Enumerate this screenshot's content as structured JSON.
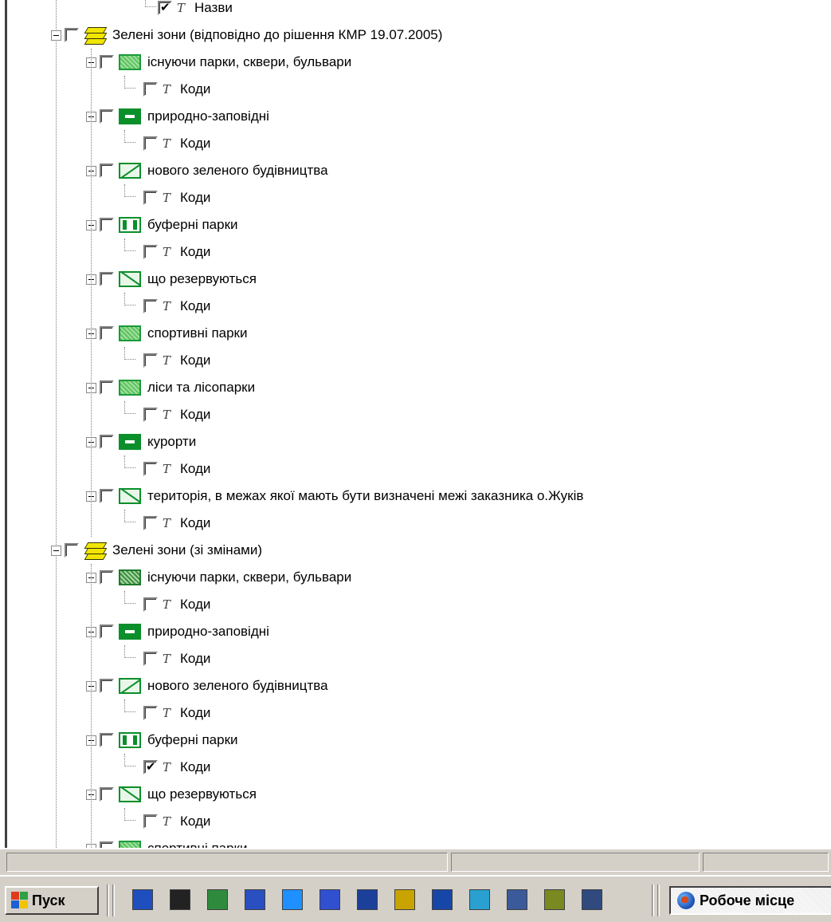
{
  "tree": {
    "top_partial": {
      "label": "Назви",
      "checked": true
    },
    "groups": [
      {
        "label": "Зелені зони (відповідно до рішення КМР 19.07.2005)",
        "checked": false,
        "layers": [
          {
            "label": "існуючи парки, сквери, бульвари",
            "symbol": "hatch",
            "checked": false,
            "child": {
              "label": "Коди",
              "checked": false
            }
          },
          {
            "label": "природно-заповідні",
            "symbol": "solid",
            "checked": false,
            "child": {
              "label": "Коди",
              "checked": false
            }
          },
          {
            "label": "нового зеленого будівництва",
            "symbol": "diag",
            "checked": false,
            "child": {
              "label": "Коди",
              "checked": false
            }
          },
          {
            "label": "буферні парки",
            "symbol": "buf",
            "checked": false,
            "child": {
              "label": "Коди",
              "checked": false
            }
          },
          {
            "label": "що резервуються",
            "symbol": "diag2",
            "checked": false,
            "child": {
              "label": "Коди",
              "checked": false
            }
          },
          {
            "label": "спортивні парки",
            "symbol": "hatch",
            "checked": false,
            "child": {
              "label": "Коди",
              "checked": false
            }
          },
          {
            "label": "ліси та лісопарки",
            "symbol": "hatch",
            "checked": false,
            "child": {
              "label": "Коди",
              "checked": false
            }
          },
          {
            "label": "курорти",
            "symbol": "solid",
            "checked": false,
            "child": {
              "label": "Коди",
              "checked": false
            }
          },
          {
            "label": "територія, в межах якої мають бути визначені межі заказника о.Жуків",
            "symbol": "diag2",
            "checked": false,
            "child": {
              "label": "Коди",
              "checked": false
            }
          }
        ]
      },
      {
        "label": "Зелені зони (зі змінами)",
        "checked": false,
        "layers": [
          {
            "label": "існуючи парки, сквери, бульвари",
            "symbol": "hatch2",
            "checked": false,
            "child": {
              "label": "Коди",
              "checked": false
            }
          },
          {
            "label": "природно-заповідні",
            "symbol": "solid",
            "checked": false,
            "child": {
              "label": "Коди",
              "checked": false
            }
          },
          {
            "label": "нового зеленого будівництва",
            "symbol": "diag",
            "checked": false,
            "child": {
              "label": "Коди",
              "checked": false
            }
          },
          {
            "label": "буферні парки",
            "symbol": "buf",
            "checked": false,
            "child": {
              "label": "Коди",
              "checked": true
            }
          },
          {
            "label": "що резервуються",
            "symbol": "diag2",
            "checked": false,
            "child": {
              "label": "Коди",
              "checked": false
            }
          },
          {
            "label": "спортивні парки",
            "symbol": "hatch",
            "checked": false,
            "child": null
          }
        ]
      }
    ]
  },
  "taskbar": {
    "start_label": "Пуск",
    "quick_launch": [
      "book-icon",
      "grid-icon",
      "excel-icon",
      "word-icon",
      "s-icon",
      "disk-icon",
      "window-icon",
      "clock-icon",
      "globe-icon",
      "sync-icon",
      "monitor-icon",
      "notepad-icon",
      "form-icon"
    ],
    "task_label": "Робоче місце"
  },
  "colors": {
    "accent_green": "#0a8f2a",
    "face": "#d4d0c8"
  }
}
